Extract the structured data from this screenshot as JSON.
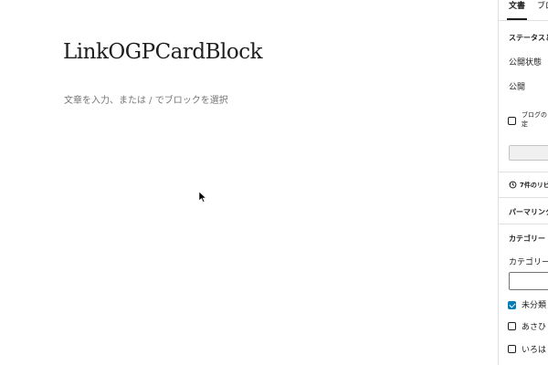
{
  "editor": {
    "post_title": "LinkOGPCardBlock",
    "block_placeholder": "文章を入力、または / でブロックを選択"
  },
  "sidebar": {
    "tabs": [
      {
        "label": "文書",
        "active": true
      },
      {
        "label": "ブロ",
        "active": false
      }
    ],
    "status_section": {
      "heading": "ステータスと公",
      "visibility_label": "公開状態",
      "publish_label": "公開",
      "blog_checkbox_label_line1": "ブログの",
      "blog_checkbox_label_line2": "定",
      "blog_checkbox_checked": false
    },
    "revisions_label": "7件のリビ",
    "permalink_heading": "パーマリンク",
    "categories": {
      "heading": "カテゴリー",
      "search_label": "カテゴリー",
      "items": [
        {
          "label": "未分類",
          "checked": true
        },
        {
          "label": "あさひ",
          "checked": false
        },
        {
          "label": "いろは",
          "checked": false
        }
      ]
    }
  },
  "colors": {
    "accent": "#007cba",
    "text": "#1e1e1e",
    "muted": "#757575",
    "border": "#e0e0e0"
  }
}
